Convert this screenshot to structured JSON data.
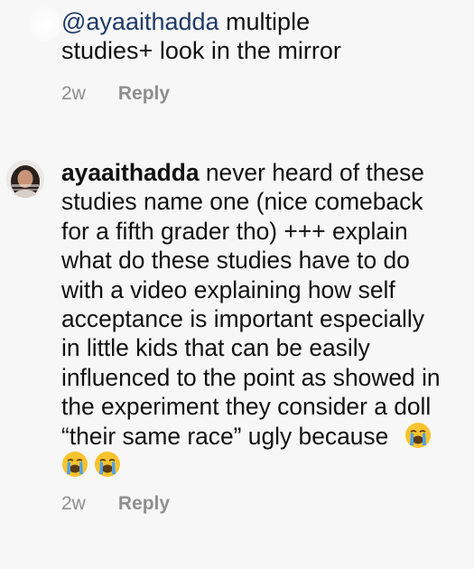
{
  "comment_top": {
    "mention": "@ayaaithadda",
    "line1_rest": " multiple",
    "line2": "studies+ look in the mirror",
    "time": "2w",
    "reply_label": "Reply"
  },
  "comment_main": {
    "username": "ayaaithadda",
    "line1_rest": " never heard of these",
    "lines": [
      "studies name one (nice comeback",
      "for a fifth grader tho) +++ explain",
      "what do these studies have to do",
      "with a video explaining how self",
      "acceptance is important especially",
      "in little kids that can be easily",
      "influenced to the point as showed in",
      "the experiment they consider a doll"
    ],
    "last_line": "“their same race” ugly because",
    "emoji_icon": "loudly-crying-face-icon",
    "time": "2w",
    "reply_label": "Reply"
  },
  "colors": {
    "background": "#f7f7f7",
    "mention": "#1f3a68",
    "meta": "#8e8e8e"
  }
}
